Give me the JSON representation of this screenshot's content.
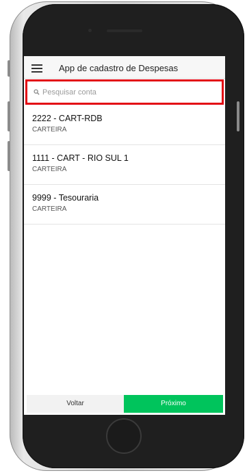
{
  "header": {
    "title": "App de cadastro de Despesas"
  },
  "search": {
    "placeholder": "Pesquisar conta",
    "value": ""
  },
  "accounts": [
    {
      "name": "2222 - CART-RDB",
      "type": "CARTEIRA"
    },
    {
      "name": "1111 - CART - RIO SUL 1",
      "type": "CARTEIRA"
    },
    {
      "name": "9999 - Tesouraria",
      "type": "CARTEIRA"
    }
  ],
  "footer": {
    "back_label": "Voltar",
    "next_label": "Próximo"
  },
  "colors": {
    "accent_green": "#00c45c",
    "highlight_red": "#e30613"
  },
  "icons": [
    "menu-icon",
    "search-icon"
  ]
}
